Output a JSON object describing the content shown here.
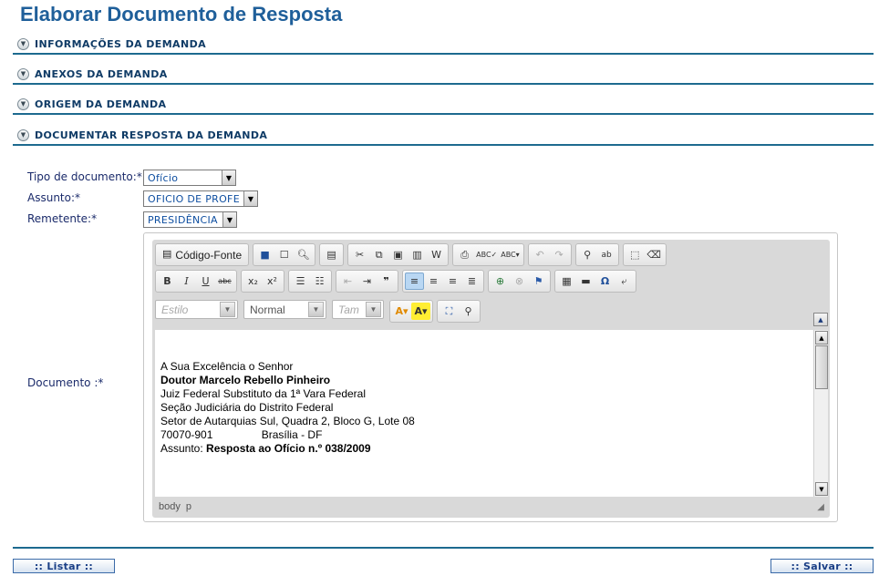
{
  "page": {
    "title": "Elaborar Documento de Resposta"
  },
  "sections": [
    {
      "title": "INFORMAÇÕES DA DEMANDA"
    },
    {
      "title": "ANEXOS DA DEMANDA"
    },
    {
      "title": "ORIGEM DA DEMANDA"
    },
    {
      "title": "DOCUMENTAR RESPOSTA DA DEMANDA"
    }
  ],
  "form": {
    "tipo_label": "Tipo de documento:*",
    "tipo_value": "Ofício",
    "assunto_label": "Assunto:*",
    "assunto_value": "OFICIO DE PROFE",
    "remetente_label": "Remetente:*",
    "remetente_value": "PRESIDÊNCIA",
    "documento_label": "Documento :*"
  },
  "editor": {
    "source_label": "Código-Fonte",
    "style_combo": "Estilo",
    "format_combo": "Normal",
    "size_combo": "Tam",
    "content_lines": [
      "A Sua Excelência o Senhor",
      "Doutor Marcelo Rebello Pinheiro",
      "Juiz Federal Substituto da 1ª Vara Federal",
      "Seção Judiciária do Distrito Federal",
      "Setor de Autarquias Sul, Quadra 2, Bloco G, Lote 08",
      "70070-901                Brasília - DF",
      "",
      "",
      "Assunto: ",
      "Resposta ao Ofício n.º 038/2009"
    ],
    "status_path": [
      "body",
      "p"
    ]
  },
  "buttons": {
    "listar": ":: Listar ::",
    "salvar": ":: Salvar ::"
  }
}
